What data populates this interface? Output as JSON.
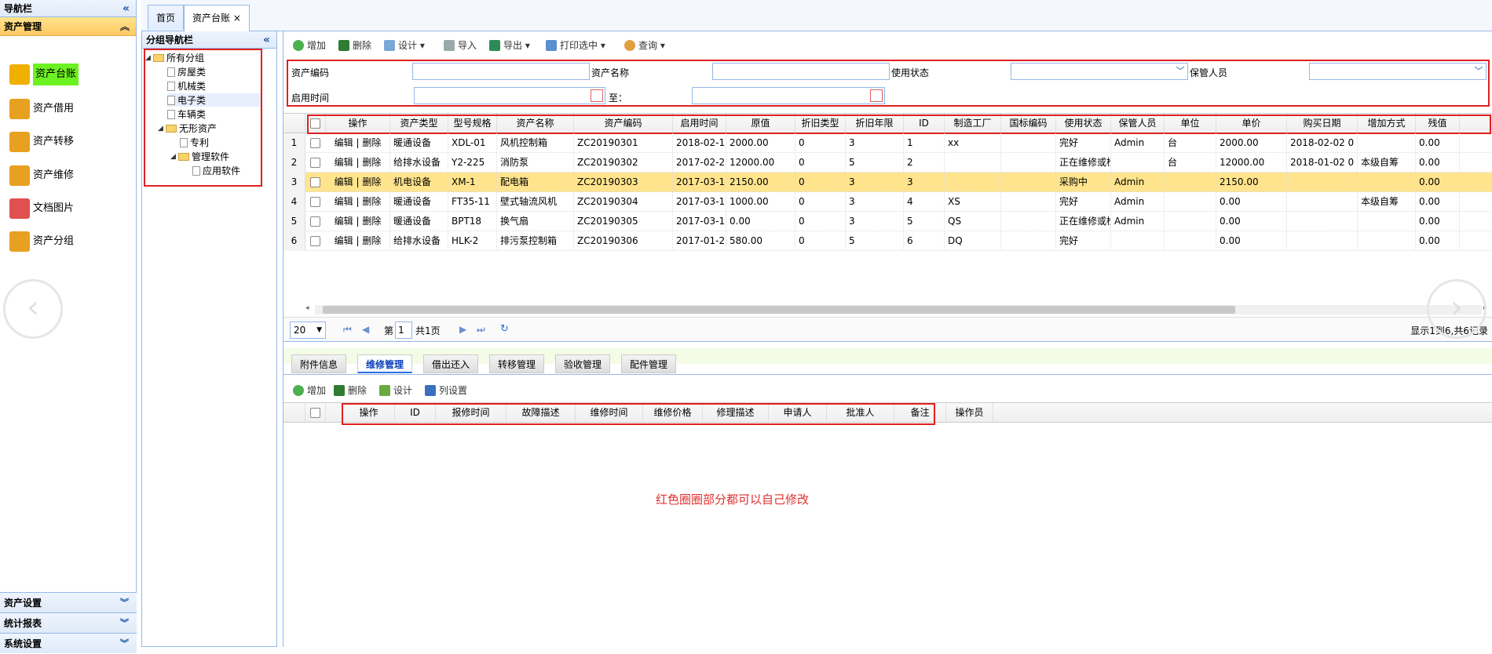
{
  "nav": {
    "title": "导航栏",
    "active_section": "资产管理",
    "items": [
      {
        "label": "资产台账",
        "color": "#f0b000"
      },
      {
        "label": "资产借用",
        "color": "#e8a020"
      },
      {
        "label": "资产转移",
        "color": "#e8a020"
      },
      {
        "label": "资产维修",
        "color": "#e8a020"
      },
      {
        "label": "文档图片",
        "color": "#e05050"
      },
      {
        "label": "资产分组",
        "color": "#e8a020"
      }
    ],
    "bottom_sections": [
      "资产设置",
      "统计报表",
      "系统设置"
    ]
  },
  "tabs": [
    {
      "label": "首页"
    },
    {
      "label": "资产台账",
      "close": "×"
    }
  ],
  "group_nav": {
    "title": "分组导航栏",
    "tree": [
      "所有分组",
      "房屋类",
      "机械类",
      "电子类",
      "车辆类",
      "无形资产",
      "专利",
      "管理软件",
      "应用软件"
    ]
  },
  "toolbar": {
    "add": "增加",
    "delete": "删除",
    "design": "设计",
    "import": "导入",
    "export": "导出",
    "print": "打印选中",
    "query": "查询"
  },
  "filters": {
    "code_label": "资产编码",
    "name_label": "资产名称",
    "status_label": "使用状态",
    "keeper_label": "保管人员",
    "start_label": "启用时间",
    "to_label": "至："
  },
  "grid": {
    "columns": [
      "操作",
      "资产类型",
      "型号规格",
      "资产名称",
      "资产编码",
      "启用时间",
      "原值",
      "折旧类型",
      "折旧年限",
      "ID",
      "制造工厂",
      "国标编码",
      "使用状态",
      "保管人员",
      "单位",
      "单价",
      "购买日期",
      "增加方式",
      "残值"
    ],
    "rows": [
      [
        "1",
        "编辑 | 删除",
        "暖通设备",
        "XDL-01",
        "风机控制箱",
        "ZC20190301",
        "2018-02-1",
        "2000.00",
        "0",
        "3",
        "1",
        "xx",
        "",
        "完好",
        "Admin",
        "台",
        "2000.00",
        "2018-02-02 0",
        "",
        "0.00"
      ],
      [
        "2",
        "编辑 | 删除",
        "给排水设备",
        "Y2-225",
        "消防泵",
        "ZC20190302",
        "2017-02-2",
        "12000.00",
        "0",
        "5",
        "2",
        "",
        "",
        "正在维修或检",
        "",
        "台",
        "12000.00",
        "2018-01-02 0",
        "本级自筹",
        "0.00"
      ],
      [
        "3",
        "编辑 | 删除",
        "机电设备",
        "XM-1",
        "配电箱",
        "ZC20190303",
        "2017-03-1",
        "2150.00",
        "0",
        "3",
        "3",
        "",
        "",
        "采购中",
        "Admin",
        "",
        "2150.00",
        "",
        "",
        "0.00"
      ],
      [
        "4",
        "编辑 | 删除",
        "暖通设备",
        "FT35-11",
        "壁式轴流风机",
        "ZC20190304",
        "2017-03-1",
        "1000.00",
        "0",
        "3",
        "4",
        "XS",
        "",
        "完好",
        "Admin",
        "",
        "0.00",
        "",
        "本级自筹",
        "0.00"
      ],
      [
        "5",
        "编辑 | 删除",
        "暖通设备",
        "BPT18",
        "换气扇",
        "ZC20190305",
        "2017-03-1",
        "0.00",
        "0",
        "3",
        "5",
        "QS",
        "",
        "正在维修或检",
        "Admin",
        "",
        "0.00",
        "",
        "",
        "0.00"
      ],
      [
        "6",
        "编辑 | 删除",
        "给排水设备",
        "HLK-2",
        "排污泵控制箱",
        "ZC20190306",
        "2017-01-2",
        "580.00",
        "0",
        "5",
        "6",
        "DQ",
        "",
        "完好",
        "",
        "",
        "0.00",
        "",
        "",
        "0.00"
      ]
    ]
  },
  "pager": {
    "page_size": "20",
    "page_prefix": "第",
    "page": "1",
    "page_total": "共1页",
    "summary": "显示1到6,共6记录"
  },
  "subtabs": [
    "附件信息",
    "维修管理",
    "借出还入",
    "转移管理",
    "验收管理",
    "配件管理"
  ],
  "sub_toolbar": {
    "add": "增加",
    "delete": "删除",
    "design": "设计",
    "columns": "列设置"
  },
  "sub_grid": {
    "columns": [
      "操作",
      "ID",
      "报修时间",
      "故障描述",
      "维修时间",
      "维修价格",
      "修理描述",
      "申请人",
      "批准人",
      "备注",
      "操作员"
    ]
  },
  "note": "红色圈圈部分都可以自己修改"
}
